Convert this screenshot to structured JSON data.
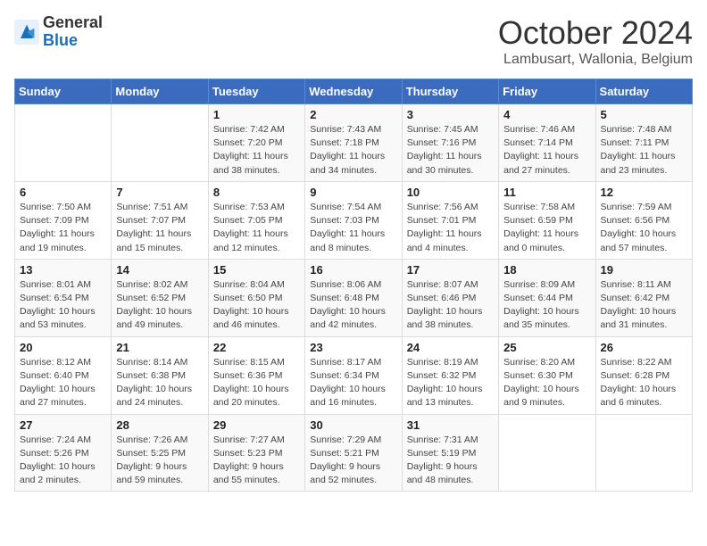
{
  "logo": {
    "general": "General",
    "blue": "Blue"
  },
  "title": "October 2024",
  "subtitle": "Lambusart, Wallonia, Belgium",
  "days_of_week": [
    "Sunday",
    "Monday",
    "Tuesday",
    "Wednesday",
    "Thursday",
    "Friday",
    "Saturday"
  ],
  "weeks": [
    [
      {
        "day": "",
        "info": ""
      },
      {
        "day": "",
        "info": ""
      },
      {
        "day": "1",
        "info": "Sunrise: 7:42 AM\nSunset: 7:20 PM\nDaylight: 11 hours and 38 minutes."
      },
      {
        "day": "2",
        "info": "Sunrise: 7:43 AM\nSunset: 7:18 PM\nDaylight: 11 hours and 34 minutes."
      },
      {
        "day": "3",
        "info": "Sunrise: 7:45 AM\nSunset: 7:16 PM\nDaylight: 11 hours and 30 minutes."
      },
      {
        "day": "4",
        "info": "Sunrise: 7:46 AM\nSunset: 7:14 PM\nDaylight: 11 hours and 27 minutes."
      },
      {
        "day": "5",
        "info": "Sunrise: 7:48 AM\nSunset: 7:11 PM\nDaylight: 11 hours and 23 minutes."
      }
    ],
    [
      {
        "day": "6",
        "info": "Sunrise: 7:50 AM\nSunset: 7:09 PM\nDaylight: 11 hours and 19 minutes."
      },
      {
        "day": "7",
        "info": "Sunrise: 7:51 AM\nSunset: 7:07 PM\nDaylight: 11 hours and 15 minutes."
      },
      {
        "day": "8",
        "info": "Sunrise: 7:53 AM\nSunset: 7:05 PM\nDaylight: 11 hours and 12 minutes."
      },
      {
        "day": "9",
        "info": "Sunrise: 7:54 AM\nSunset: 7:03 PM\nDaylight: 11 hours and 8 minutes."
      },
      {
        "day": "10",
        "info": "Sunrise: 7:56 AM\nSunset: 7:01 PM\nDaylight: 11 hours and 4 minutes."
      },
      {
        "day": "11",
        "info": "Sunrise: 7:58 AM\nSunset: 6:59 PM\nDaylight: 11 hours and 0 minutes."
      },
      {
        "day": "12",
        "info": "Sunrise: 7:59 AM\nSunset: 6:56 PM\nDaylight: 10 hours and 57 minutes."
      }
    ],
    [
      {
        "day": "13",
        "info": "Sunrise: 8:01 AM\nSunset: 6:54 PM\nDaylight: 10 hours and 53 minutes."
      },
      {
        "day": "14",
        "info": "Sunrise: 8:02 AM\nSunset: 6:52 PM\nDaylight: 10 hours and 49 minutes."
      },
      {
        "day": "15",
        "info": "Sunrise: 8:04 AM\nSunset: 6:50 PM\nDaylight: 10 hours and 46 minutes."
      },
      {
        "day": "16",
        "info": "Sunrise: 8:06 AM\nSunset: 6:48 PM\nDaylight: 10 hours and 42 minutes."
      },
      {
        "day": "17",
        "info": "Sunrise: 8:07 AM\nSunset: 6:46 PM\nDaylight: 10 hours and 38 minutes."
      },
      {
        "day": "18",
        "info": "Sunrise: 8:09 AM\nSunset: 6:44 PM\nDaylight: 10 hours and 35 minutes."
      },
      {
        "day": "19",
        "info": "Sunrise: 8:11 AM\nSunset: 6:42 PM\nDaylight: 10 hours and 31 minutes."
      }
    ],
    [
      {
        "day": "20",
        "info": "Sunrise: 8:12 AM\nSunset: 6:40 PM\nDaylight: 10 hours and 27 minutes."
      },
      {
        "day": "21",
        "info": "Sunrise: 8:14 AM\nSunset: 6:38 PM\nDaylight: 10 hours and 24 minutes."
      },
      {
        "day": "22",
        "info": "Sunrise: 8:15 AM\nSunset: 6:36 PM\nDaylight: 10 hours and 20 minutes."
      },
      {
        "day": "23",
        "info": "Sunrise: 8:17 AM\nSunset: 6:34 PM\nDaylight: 10 hours and 16 minutes."
      },
      {
        "day": "24",
        "info": "Sunrise: 8:19 AM\nSunset: 6:32 PM\nDaylight: 10 hours and 13 minutes."
      },
      {
        "day": "25",
        "info": "Sunrise: 8:20 AM\nSunset: 6:30 PM\nDaylight: 10 hours and 9 minutes."
      },
      {
        "day": "26",
        "info": "Sunrise: 8:22 AM\nSunset: 6:28 PM\nDaylight: 10 hours and 6 minutes."
      }
    ],
    [
      {
        "day": "27",
        "info": "Sunrise: 7:24 AM\nSunset: 5:26 PM\nDaylight: 10 hours and 2 minutes."
      },
      {
        "day": "28",
        "info": "Sunrise: 7:26 AM\nSunset: 5:25 PM\nDaylight: 9 hours and 59 minutes."
      },
      {
        "day": "29",
        "info": "Sunrise: 7:27 AM\nSunset: 5:23 PM\nDaylight: 9 hours and 55 minutes."
      },
      {
        "day": "30",
        "info": "Sunrise: 7:29 AM\nSunset: 5:21 PM\nDaylight: 9 hours and 52 minutes."
      },
      {
        "day": "31",
        "info": "Sunrise: 7:31 AM\nSunset: 5:19 PM\nDaylight: 9 hours and 48 minutes."
      },
      {
        "day": "",
        "info": ""
      },
      {
        "day": "",
        "info": ""
      }
    ]
  ]
}
